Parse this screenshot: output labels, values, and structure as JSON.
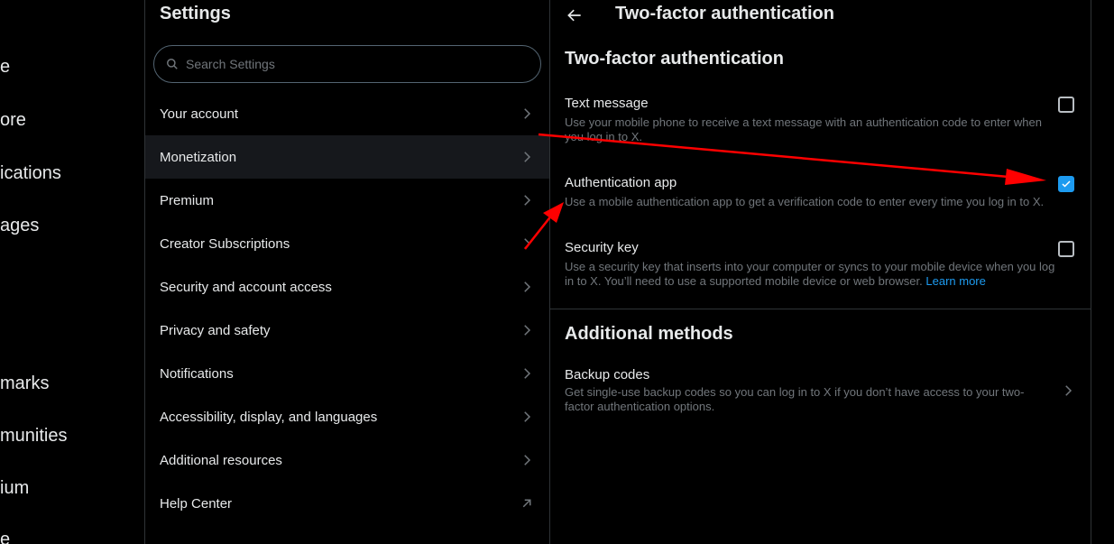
{
  "leftnav": {
    "items": [
      "e",
      "ore",
      "ications",
      "ages",
      "marks",
      "munities",
      "ium",
      "e"
    ]
  },
  "settings": {
    "title": "Settings",
    "search_placeholder": "Search Settings",
    "items": [
      {
        "label": "Your account",
        "icon": "chevron-right-icon"
      },
      {
        "label": "Monetization",
        "icon": "chevron-right-icon"
      },
      {
        "label": "Premium",
        "icon": "chevron-right-icon"
      },
      {
        "label": "Creator Subscriptions",
        "icon": "chevron-right-icon"
      },
      {
        "label": "Security and account access",
        "icon": "chevron-right-icon"
      },
      {
        "label": "Privacy and safety",
        "icon": "chevron-right-icon"
      },
      {
        "label": "Notifications",
        "icon": "chevron-right-icon"
      },
      {
        "label": "Accessibility, display, and languages",
        "icon": "chevron-right-icon"
      },
      {
        "label": "Additional resources",
        "icon": "chevron-right-icon"
      },
      {
        "label": "Help Center",
        "icon": "external-link-icon"
      }
    ],
    "active_item": "Monetization"
  },
  "detail": {
    "header_title": "Two-factor authentication",
    "section1_title": "Two-factor authentication",
    "options": [
      {
        "label": "Text message",
        "desc": "Use your mobile phone to receive a text message with an authentication code to enter when you log in to X.",
        "checked": false
      },
      {
        "label": "Authentication app",
        "desc": "Use a mobile authentication app to get a verification code to enter every time you log in to X.",
        "checked": true
      },
      {
        "label": "Security key",
        "desc": "Use a security key that inserts into your computer or syncs to your mobile device when you log in to X. You’ll need to use a supported mobile device or web browser.",
        "link": "Learn more",
        "checked": false
      }
    ],
    "section2_title": "Additional methods",
    "backup": {
      "label": "Backup codes",
      "desc": "Get single-use backup codes so you can log in to X if you don’t have access to your two-factor authentication options."
    }
  },
  "colors": {
    "background": "#000000",
    "text": "#e7e9ea",
    "muted": "#71767b",
    "accent": "#1d9bf0",
    "annotation_arrow": "#ff0000"
  }
}
